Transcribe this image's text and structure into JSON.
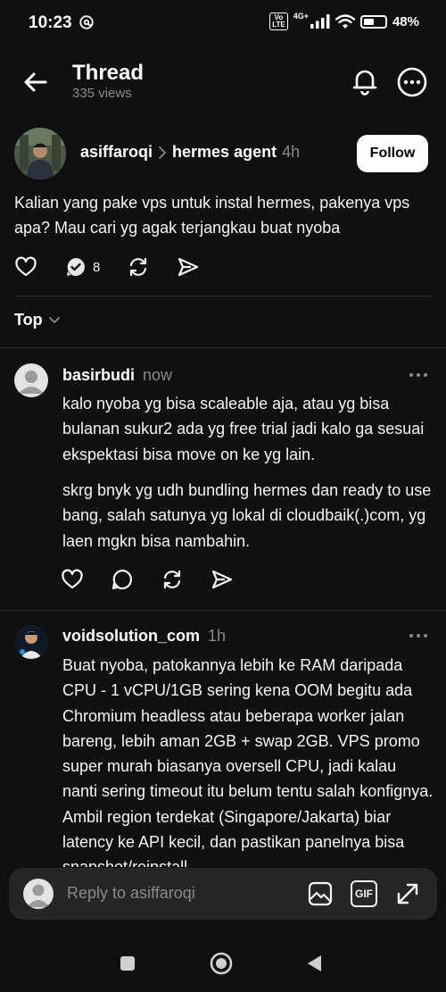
{
  "status": {
    "time": "10:23",
    "volte_top": "Vo",
    "volte_bottom": "LTE",
    "network": "4G+",
    "battery_text": "48%",
    "battery_level": 0.48
  },
  "header": {
    "title": "Thread",
    "views": "335 views"
  },
  "post": {
    "username": "asiffaroqi",
    "topic": "hermes agent",
    "time": "4h",
    "follow_label": "Follow",
    "text": "Kalian yang pake vps untuk instal hermes, pakenya vps apa? Mau cari yg agak terjangkau buat nyoba",
    "reply_count": "8"
  },
  "sort": {
    "label": "Top"
  },
  "replies": [
    {
      "username": "basirbudi",
      "time": "now",
      "paragraphs": [
        "kalo nyoba yg bisa scaleable aja, atau yg bisa bulanan sukur2 ada yg free trial jadi kalo ga sesuai ekspektasi bisa move on ke yg lain.",
        "skrg bnyk yg udh bundling hermes dan ready to use bang, salah satunya yg lokal di cloudbaik(.)com, yg laen mgkn bisa nambahin."
      ]
    },
    {
      "username": "voidsolution_com",
      "time": "1h",
      "paragraphs": [
        "Buat nyoba, patokannya lebih ke RAM daripada CPU - 1 vCPU/1GB sering kena OOM begitu ada Chromium headless atau beberapa worker jalan bareng, lebih aman 2GB + swap 2GB. VPS promo super murah biasanya oversell CPU, jadi kalau nanti sering timeout itu belum tentu salah konfignya. Ambil region terdekat (Singapore/Jakarta) biar latency ke API kecil, dan pastikan panelnya bisa snapshot/reinstall"
      ]
    }
  ],
  "reply_bar": {
    "placeholder": "Reply to asiffaroqi",
    "gif_label": "GIF"
  },
  "icons": {
    "back": "arrow-left-icon",
    "bell": "bell-icon",
    "more": "more-horizontal-icon",
    "like": "heart-icon",
    "reply": "comment-icon",
    "repost": "repost-icon",
    "share": "send-icon",
    "image": "image-icon",
    "expand": "expand-icon"
  }
}
